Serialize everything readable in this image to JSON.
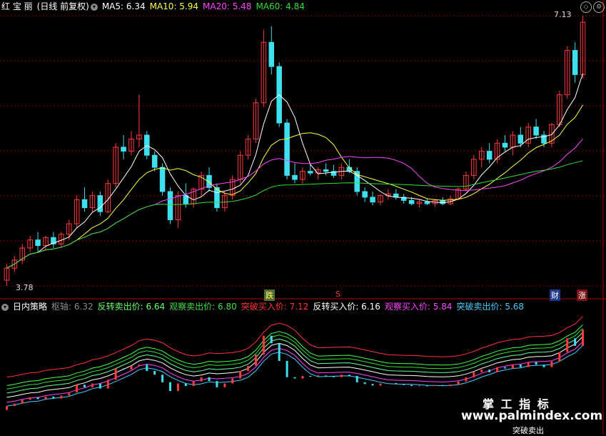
{
  "header": {
    "stock_name": "红 宝 丽",
    "mode": "(日线 前复权)",
    "ma5": "MA5: 6.34",
    "ma10": "MA10: 5.94",
    "ma20": "MA20: 5.48",
    "ma60": "MA60: 4.84"
  },
  "indicator_header": {
    "name": "日内策略",
    "pivot": "枢轴: 6.32",
    "rev_sell": "反转卖出价: 6.64",
    "obs_sell": "观察卖出价: 6.80",
    "brk_buy": "突破买入价: 7.12",
    "rev_buy": "反转买入价: 6.16",
    "obs_buy": "观察买入价: 5.84",
    "brk_sell": "突破卖出价: 5.68"
  },
  "annotations": {
    "high_label": "7.13",
    "low_label": "3.78",
    "mark_1": "跌",
    "mark_2": "S",
    "mark_3": "财",
    "mark_4": "涨"
  },
  "watermark": {
    "line1": "掌 工 指 标",
    "line2": "www.palmindex.com",
    "line3": "突破卖出"
  },
  "colors": {
    "up": "#ff3b3b",
    "down": "#3ee0f0",
    "ma5": "#ffffff",
    "ma10": "#ffff44",
    "ma20": "#ff44ff",
    "ma60": "#33dd33",
    "grid": "#8b0000"
  },
  "chart_data": {
    "type": "candlestick",
    "price_range": [
      3.78,
      7.13
    ],
    "candles": [
      {
        "o": 3.85,
        "h": 4.05,
        "l": 3.78,
        "c": 4.0
      },
      {
        "o": 4.0,
        "h": 4.15,
        "l": 3.95,
        "c": 4.1
      },
      {
        "o": 4.1,
        "h": 4.3,
        "l": 4.05,
        "c": 4.25
      },
      {
        "o": 4.25,
        "h": 4.4,
        "l": 4.2,
        "c": 4.35
      },
      {
        "o": 4.35,
        "h": 4.45,
        "l": 4.2,
        "c": 4.28
      },
      {
        "o": 4.28,
        "h": 4.4,
        "l": 4.22,
        "c": 4.38
      },
      {
        "o": 4.38,
        "h": 4.45,
        "l": 4.25,
        "c": 4.3
      },
      {
        "o": 4.3,
        "h": 4.45,
        "l": 4.25,
        "c": 4.42
      },
      {
        "o": 4.42,
        "h": 4.6,
        "l": 4.35,
        "c": 4.55
      },
      {
        "o": 4.55,
        "h": 4.9,
        "l": 4.5,
        "c": 4.85
      },
      {
        "o": 4.85,
        "h": 5.0,
        "l": 4.7,
        "c": 4.75
      },
      {
        "o": 4.75,
        "h": 4.95,
        "l": 4.7,
        "c": 4.9
      },
      {
        "o": 4.9,
        "h": 4.95,
        "l": 4.65,
        "c": 4.7
      },
      {
        "o": 4.7,
        "h": 5.1,
        "l": 4.68,
        "c": 5.05
      },
      {
        "o": 5.05,
        "h": 5.55,
        "l": 5.0,
        "c": 5.5
      },
      {
        "o": 5.5,
        "h": 5.65,
        "l": 5.35,
        "c": 5.45
      },
      {
        "o": 5.45,
        "h": 5.7,
        "l": 5.4,
        "c": 5.6
      },
      {
        "o": 5.6,
        "h": 6.15,
        "l": 5.5,
        "c": 5.65
      },
      {
        "o": 5.65,
        "h": 5.7,
        "l": 5.35,
        "c": 5.4
      },
      {
        "o": 5.4,
        "h": 5.45,
        "l": 5.2,
        "c": 5.25
      },
      {
        "o": 5.25,
        "h": 5.3,
        "l": 4.9,
        "c": 4.95
      },
      {
        "o": 4.95,
        "h": 5.0,
        "l": 4.55,
        "c": 4.6
      },
      {
        "o": 4.6,
        "h": 4.95,
        "l": 4.5,
        "c": 4.9
      },
      {
        "o": 4.9,
        "h": 5.05,
        "l": 4.75,
        "c": 4.8
      },
      {
        "o": 4.8,
        "h": 5.0,
        "l": 4.75,
        "c": 4.98
      },
      {
        "o": 4.98,
        "h": 5.2,
        "l": 4.9,
        "c": 5.15
      },
      {
        "o": 5.15,
        "h": 5.25,
        "l": 4.95,
        "c": 5.0
      },
      {
        "o": 5.0,
        "h": 5.05,
        "l": 4.7,
        "c": 4.75
      },
      {
        "o": 4.75,
        "h": 4.95,
        "l": 4.7,
        "c": 4.9
      },
      {
        "o": 4.9,
        "h": 5.15,
        "l": 4.85,
        "c": 5.1
      },
      {
        "o": 5.1,
        "h": 5.45,
        "l": 5.05,
        "c": 5.4
      },
      {
        "o": 5.4,
        "h": 5.65,
        "l": 5.35,
        "c": 5.6
      },
      {
        "o": 5.6,
        "h": 6.1,
        "l": 5.55,
        "c": 6.05
      },
      {
        "o": 6.05,
        "h": 6.95,
        "l": 6.0,
        "c": 6.8
      },
      {
        "o": 6.8,
        "h": 7.0,
        "l": 6.4,
        "c": 6.5
      },
      {
        "o": 6.5,
        "h": 6.55,
        "l": 5.75,
        "c": 5.8
      },
      {
        "o": 5.8,
        "h": 5.85,
        "l": 5.1,
        "c": 5.15
      },
      {
        "o": 5.15,
        "h": 5.3,
        "l": 5.05,
        "c": 5.1
      },
      {
        "o": 5.1,
        "h": 5.25,
        "l": 5.05,
        "c": 5.2
      },
      {
        "o": 5.2,
        "h": 5.3,
        "l": 5.15,
        "c": 5.18
      },
      {
        "o": 5.18,
        "h": 5.25,
        "l": 5.1,
        "c": 5.22
      },
      {
        "o": 5.22,
        "h": 5.3,
        "l": 5.15,
        "c": 5.2
      },
      {
        "o": 5.2,
        "h": 5.28,
        "l": 5.12,
        "c": 5.15
      },
      {
        "o": 5.15,
        "h": 5.3,
        "l": 5.1,
        "c": 5.25
      },
      {
        "o": 5.25,
        "h": 5.35,
        "l": 5.18,
        "c": 5.2
      },
      {
        "o": 5.2,
        "h": 5.25,
        "l": 4.9,
        "c": 4.95
      },
      {
        "o": 4.95,
        "h": 5.0,
        "l": 4.82,
        "c": 4.88
      },
      {
        "o": 4.88,
        "h": 4.95,
        "l": 4.78,
        "c": 4.82
      },
      {
        "o": 4.82,
        "h": 4.92,
        "l": 4.78,
        "c": 4.9
      },
      {
        "o": 4.9,
        "h": 4.98,
        "l": 4.85,
        "c": 4.92
      },
      {
        "o": 4.92,
        "h": 4.98,
        "l": 4.85,
        "c": 4.88
      },
      {
        "o": 4.88,
        "h": 4.92,
        "l": 4.8,
        "c": 4.84
      },
      {
        "o": 4.84,
        "h": 4.88,
        "l": 4.78,
        "c": 4.8
      },
      {
        "o": 4.8,
        "h": 4.85,
        "l": 4.75,
        "c": 4.82
      },
      {
        "o": 4.82,
        "h": 4.86,
        "l": 4.78,
        "c": 4.8
      },
      {
        "o": 4.8,
        "h": 4.86,
        "l": 4.76,
        "c": 4.84
      },
      {
        "o": 4.84,
        "h": 4.88,
        "l": 4.78,
        "c": 4.8
      },
      {
        "o": 4.8,
        "h": 4.9,
        "l": 4.78,
        "c": 4.86
      },
      {
        "o": 4.86,
        "h": 5.0,
        "l": 4.84,
        "c": 4.98
      },
      {
        "o": 4.98,
        "h": 5.2,
        "l": 4.95,
        "c": 5.15
      },
      {
        "o": 5.15,
        "h": 5.4,
        "l": 5.1,
        "c": 5.35
      },
      {
        "o": 5.35,
        "h": 5.5,
        "l": 5.25,
        "c": 5.45
      },
      {
        "o": 5.45,
        "h": 5.55,
        "l": 5.3,
        "c": 5.35
      },
      {
        "o": 5.35,
        "h": 5.6,
        "l": 5.3,
        "c": 5.55
      },
      {
        "o": 5.55,
        "h": 5.65,
        "l": 5.45,
        "c": 5.5
      },
      {
        "o": 5.5,
        "h": 5.7,
        "l": 5.4,
        "c": 5.65
      },
      {
        "o": 5.65,
        "h": 5.75,
        "l": 5.5,
        "c": 5.55
      },
      {
        "o": 5.55,
        "h": 5.8,
        "l": 5.5,
        "c": 5.75
      },
      {
        "o": 5.75,
        "h": 5.85,
        "l": 5.6,
        "c": 5.65
      },
      {
        "o": 5.65,
        "h": 5.7,
        "l": 5.5,
        "c": 5.55
      },
      {
        "o": 5.55,
        "h": 5.8,
        "l": 5.5,
        "c": 5.78
      },
      {
        "o": 5.78,
        "h": 6.2,
        "l": 5.75,
        "c": 6.15
      },
      {
        "o": 6.15,
        "h": 6.75,
        "l": 6.1,
        "c": 6.7
      },
      {
        "o": 6.7,
        "h": 6.8,
        "l": 6.3,
        "c": 6.4
      },
      {
        "o": 6.4,
        "h": 7.13,
        "l": 6.35,
        "c": 7.05
      }
    ]
  }
}
